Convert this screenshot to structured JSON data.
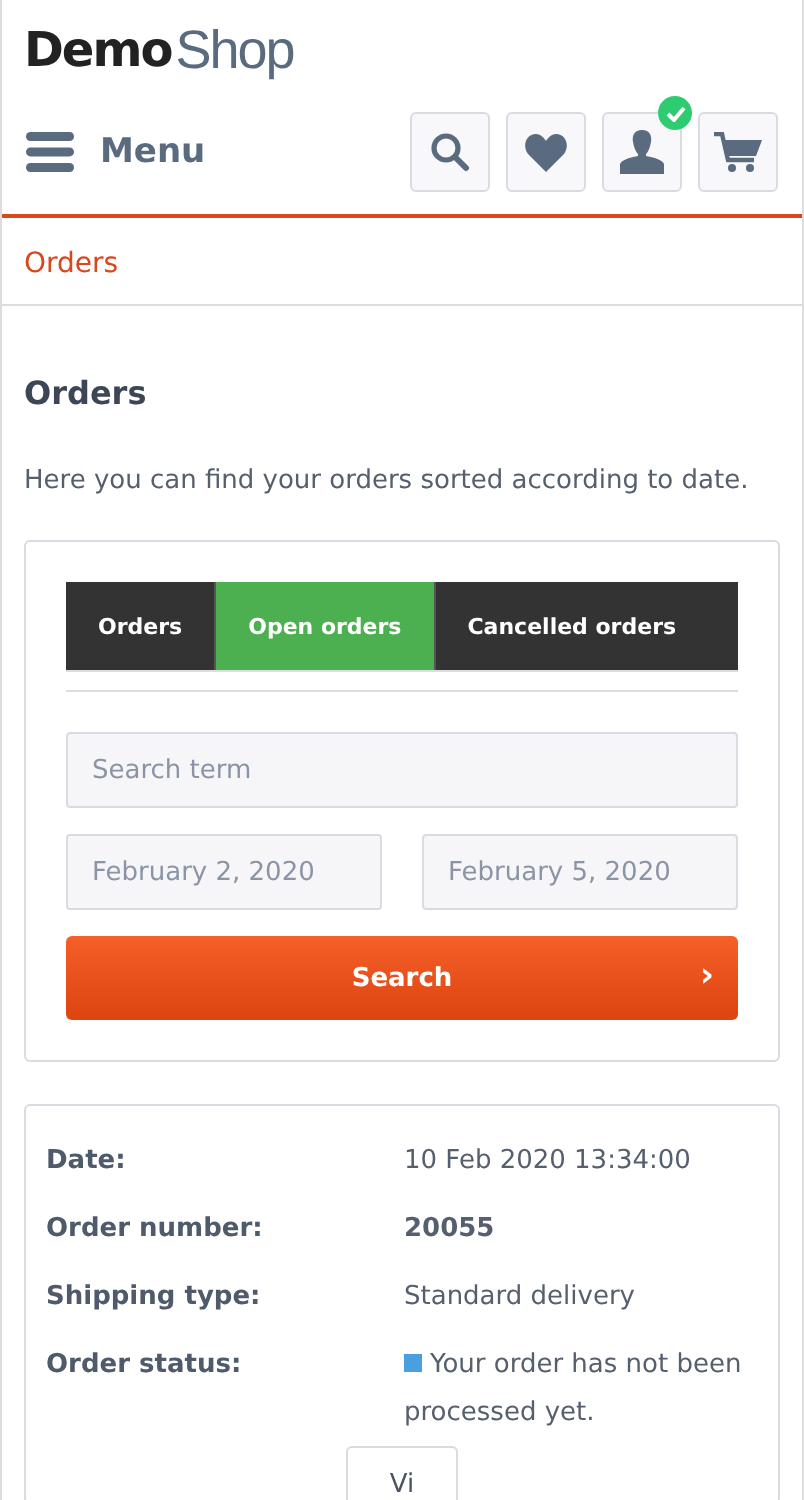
{
  "logo": {
    "bold": "Demo",
    "light": "Shop"
  },
  "header": {
    "menu_label": "Menu",
    "icon_buttons": [
      {
        "kind": "search",
        "badge": false
      },
      {
        "kind": "heart",
        "badge": false
      },
      {
        "kind": "user",
        "badge": true
      },
      {
        "kind": "cart",
        "badge": false
      }
    ]
  },
  "breadcrumb": [
    "Orders"
  ],
  "page": {
    "title": "Orders",
    "intro": "Here you can find your orders sorted according to date."
  },
  "filter": {
    "tabs": [
      {
        "label": "Orders",
        "selected": false
      },
      {
        "label": "Open orders",
        "selected": true
      },
      {
        "label": "Cancelled orders",
        "selected": false
      }
    ],
    "search_field": {
      "placeholder": "Search term"
    },
    "date_from": {
      "placeholder": "February 2, 2020"
    },
    "date_to": {
      "placeholder": "February 5, 2020"
    },
    "search_button": {
      "label": "Search",
      "chevron": "›"
    }
  },
  "order": {
    "rows": [
      {
        "label": "Date:",
        "value": "10 Feb 2020 13:34:00",
        "kind": "plain"
      },
      {
        "label": "Order number:",
        "value": "20055",
        "kind": "bold"
      },
      {
        "label": "Shipping type:",
        "value": "Standard delivery",
        "kind": "plain"
      },
      {
        "label": "Order status:",
        "value": "Your order has not been processed yet.",
        "kind": "status",
        "color": "#4a9fde"
      }
    ],
    "view_button": "Vi"
  }
}
